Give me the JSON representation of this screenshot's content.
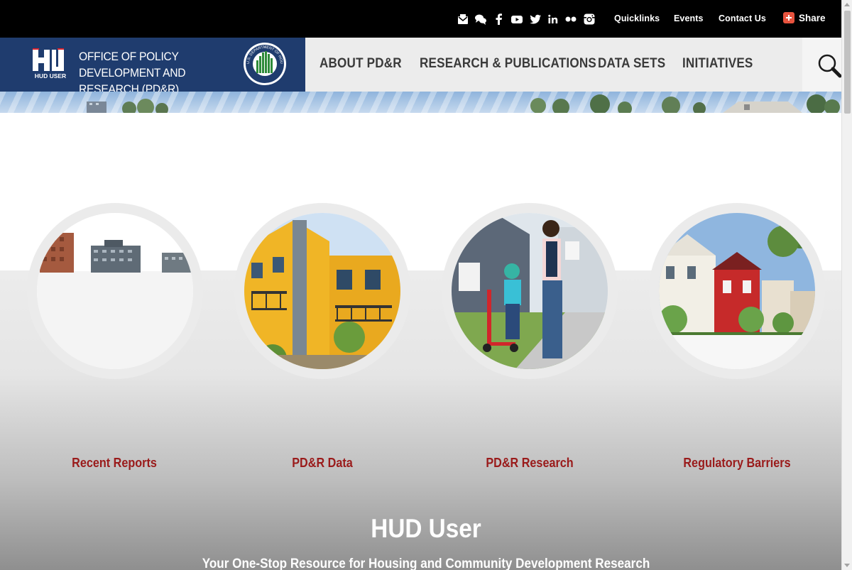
{
  "topbar": {
    "social_icons": [
      "email-icon",
      "comments-icon",
      "facebook-icon",
      "youtube-icon",
      "twitter-icon",
      "linkedin-icon",
      "flickr-icon",
      "instagram-icon"
    ],
    "links": [
      "Quicklinks",
      "Events",
      "Contact Us"
    ],
    "share_label": "Share",
    "share_color": "#e8533e"
  },
  "header": {
    "logo_text": "HUD USER",
    "office_title": "OFFICE OF POLICY DEVELOPMENT AND RESEARCH (PD&R)",
    "seal_text": "U.S. DEPARTMENT OF HOUSING AND URBAN DEVELOPMENT",
    "brand_color": "#1f3c6e"
  },
  "nav": {
    "items": [
      "ABOUT PD&R",
      "RESEARCH & PUBLICATIONS",
      "DATA SETS",
      "INITIATIVES"
    ]
  },
  "features": [
    {
      "title": "Recent Reports",
      "image": "city-skyline"
    },
    {
      "title": "PD&R Data",
      "image": "yellow-townhouses"
    },
    {
      "title": "PD&R Research",
      "image": "mother-child-scooter"
    },
    {
      "title": "Regulatory Barriers",
      "image": "row-houses"
    }
  ],
  "hero": {
    "heading": "HUD User",
    "subheading": "Your One-Stop Resource for Housing and Community Development Research"
  },
  "colors": {
    "feature_title": "#9a1b1b",
    "nav_bg": "#ececec"
  }
}
